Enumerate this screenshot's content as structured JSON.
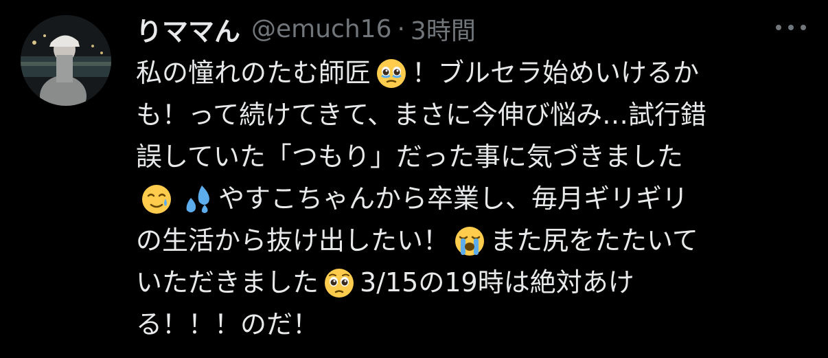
{
  "tweet": {
    "author": {
      "display_name": "りママん",
      "handle": "@emuch16",
      "avatar_icon": "profile-photo"
    },
    "separator": "·",
    "timestamp": "3時間",
    "more_icon": "more-options-icon",
    "text_lines": [
      [
        "私の憧れのたむ師匠",
        "[emoji:pleading-tears]",
        "！ブルセラ始めいけるか"
      ],
      [
        "も！って続けてきて、まさに今伸び悩み…試行錯"
      ],
      [
        "誤していた「つもり」だった事に気づきました"
      ],
      [
        "[emoji:smiling-tear]",
        "[emoji:sweat-droplets]",
        "やすこちゃんから卒業し、毎月ギリギリ"
      ],
      [
        "の生活から抜け出したい！",
        "[emoji:loudly-crying]",
        "また尻をたたいて"
      ],
      [
        "いただきました",
        "[emoji:pleading]",
        "3/15の19時は絶対あけ"
      ],
      [
        "る！！！のだ！"
      ]
    ],
    "segments": {
      "l1a": "私の憧れのたむ師匠",
      "l1b": "！ブルセラ始めいけるか",
      "l2": "も！って続けてきて、まさに今伸び悩み…試行錯",
      "l3": "誤していた「つもり」だった事に気づきました",
      "l4": "やすこちゃんから卒業し、毎月ギリギリ",
      "l5a": "の生活から抜け出したい！",
      "l5b": "また尻をたたいて",
      "l6a": "いただきました",
      "l6b": "3/15の19時は絶対あけ",
      "l7": "る！！！のだ！"
    },
    "emoji_names": [
      "pleading-tears-emoji",
      "smiling-tear-emoji",
      "sweat-droplets-emoji",
      "loudly-crying-emoji",
      "pleading-emoji"
    ]
  },
  "colors": {
    "background": "#000000",
    "primary_text": "#e7e9ea",
    "secondary_text": "#71767b"
  }
}
